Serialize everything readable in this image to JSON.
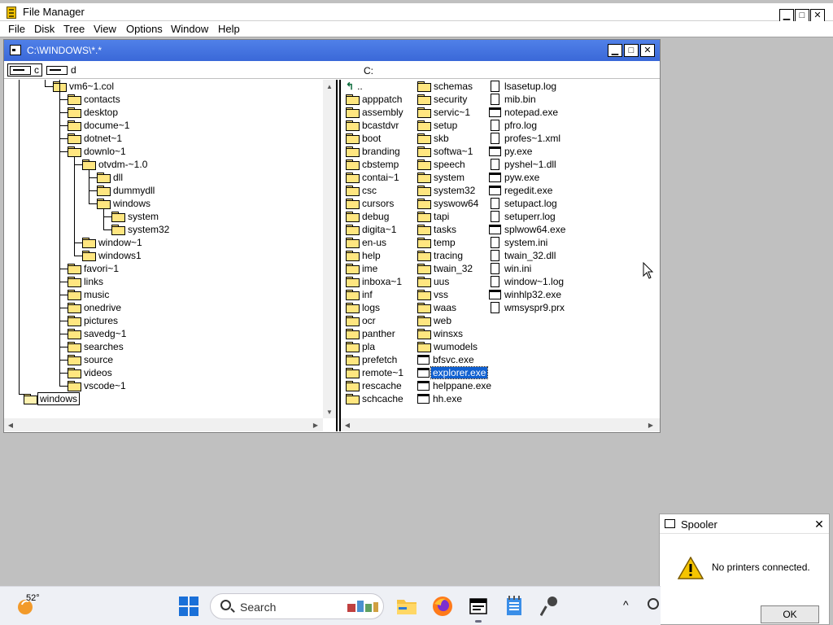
{
  "file_manager": {
    "title": "File Manager",
    "menu": [
      "File",
      "Disk",
      "Tree",
      "View",
      "Options",
      "Window",
      "Help"
    ]
  },
  "child_window": {
    "title": "C:\\WINDOWS\\*.*",
    "drives": [
      {
        "label": "c",
        "selected": true
      },
      {
        "label": "d",
        "selected": false
      }
    ],
    "current_drive": "C:"
  },
  "tree": [
    {
      "name": "vm6~1.col",
      "depth": 1
    },
    {
      "name": "contacts",
      "depth": 2
    },
    {
      "name": "desktop",
      "depth": 2
    },
    {
      "name": "docume~1",
      "depth": 2
    },
    {
      "name": "dotnet~1",
      "depth": 2
    },
    {
      "name": "downlo~1",
      "depth": 2
    },
    {
      "name": "otvdm-~1.0",
      "depth": 3
    },
    {
      "name": "dll",
      "depth": 4
    },
    {
      "name": "dummydll",
      "depth": 4
    },
    {
      "name": "windows",
      "depth": 4
    },
    {
      "name": "system",
      "depth": 5
    },
    {
      "name": "system32",
      "depth": 5
    },
    {
      "name": "window~1",
      "depth": 3
    },
    {
      "name": "windows1",
      "depth": 3
    },
    {
      "name": "favori~1",
      "depth": 2
    },
    {
      "name": "links",
      "depth": 2
    },
    {
      "name": "music",
      "depth": 2
    },
    {
      "name": "onedrive",
      "depth": 2
    },
    {
      "name": "pictures",
      "depth": 2
    },
    {
      "name": "savedg~1",
      "depth": 2
    },
    {
      "name": "searches",
      "depth": 2
    },
    {
      "name": "source",
      "depth": 2
    },
    {
      "name": "videos",
      "depth": 2
    },
    {
      "name": "vscode~1",
      "depth": 2
    },
    {
      "name": "windows",
      "depth": 0,
      "open": true,
      "focused": true
    }
  ],
  "files": {
    "col1": [
      {
        "name": "..",
        "type": "up"
      },
      {
        "name": "apppatch",
        "type": "folder"
      },
      {
        "name": "assembly",
        "type": "folder"
      },
      {
        "name": "bcastdvr",
        "type": "folder"
      },
      {
        "name": "boot",
        "type": "folder"
      },
      {
        "name": "branding",
        "type": "folder"
      },
      {
        "name": "cbstemp",
        "type": "folder"
      },
      {
        "name": "contai~1",
        "type": "folder"
      },
      {
        "name": "csc",
        "type": "folder"
      },
      {
        "name": "cursors",
        "type": "folder"
      },
      {
        "name": "debug",
        "type": "folder"
      },
      {
        "name": "digita~1",
        "type": "folder"
      },
      {
        "name": "en-us",
        "type": "folder"
      },
      {
        "name": "help",
        "type": "folder"
      },
      {
        "name": "ime",
        "type": "folder"
      },
      {
        "name": "inboxa~1",
        "type": "folder"
      },
      {
        "name": "inf",
        "type": "folder"
      },
      {
        "name": "logs",
        "type": "folder"
      },
      {
        "name": "ocr",
        "type": "folder"
      },
      {
        "name": "panther",
        "type": "folder"
      },
      {
        "name": "pla",
        "type": "folder"
      },
      {
        "name": "prefetch",
        "type": "folder"
      },
      {
        "name": "remote~1",
        "type": "folder"
      },
      {
        "name": "rescache",
        "type": "folder"
      },
      {
        "name": "schcache",
        "type": "folder"
      }
    ],
    "col2": [
      {
        "name": "schemas",
        "type": "folder"
      },
      {
        "name": "security",
        "type": "folder"
      },
      {
        "name": "servic~1",
        "type": "folder"
      },
      {
        "name": "setup",
        "type": "folder"
      },
      {
        "name": "skb",
        "type": "folder"
      },
      {
        "name": "softwa~1",
        "type": "folder"
      },
      {
        "name": "speech",
        "type": "folder"
      },
      {
        "name": "system",
        "type": "folder"
      },
      {
        "name": "system32",
        "type": "folder"
      },
      {
        "name": "syswow64",
        "type": "folder"
      },
      {
        "name": "tapi",
        "type": "folder"
      },
      {
        "name": "tasks",
        "type": "folder"
      },
      {
        "name": "temp",
        "type": "folder"
      },
      {
        "name": "tracing",
        "type": "folder"
      },
      {
        "name": "twain_32",
        "type": "folder"
      },
      {
        "name": "uus",
        "type": "folder"
      },
      {
        "name": "vss",
        "type": "folder"
      },
      {
        "name": "waas",
        "type": "folder"
      },
      {
        "name": "web",
        "type": "folder"
      },
      {
        "name": "winsxs",
        "type": "folder"
      },
      {
        "name": "wumodels",
        "type": "folder"
      },
      {
        "name": "bfsvc.exe",
        "type": "exe"
      },
      {
        "name": "explorer.exe",
        "type": "exe",
        "selected": true
      },
      {
        "name": "helppane.exe",
        "type": "exe"
      },
      {
        "name": "hh.exe",
        "type": "exe"
      }
    ],
    "col3": [
      {
        "name": "lsasetup.log",
        "type": "file"
      },
      {
        "name": "mib.bin",
        "type": "file"
      },
      {
        "name": "notepad.exe",
        "type": "exe"
      },
      {
        "name": "pfro.log",
        "type": "file"
      },
      {
        "name": "profes~1.xml",
        "type": "file"
      },
      {
        "name": "py.exe",
        "type": "exe"
      },
      {
        "name": "pyshel~1.dll",
        "type": "file"
      },
      {
        "name": "pyw.exe",
        "type": "exe"
      },
      {
        "name": "regedit.exe",
        "type": "exe"
      },
      {
        "name": "setupact.log",
        "type": "file"
      },
      {
        "name": "setuperr.log",
        "type": "file"
      },
      {
        "name": "splwow64.exe",
        "type": "exe"
      },
      {
        "name": "system.ini",
        "type": "file"
      },
      {
        "name": "twain_32.dll",
        "type": "file"
      },
      {
        "name": "win.ini",
        "type": "file"
      },
      {
        "name": "window~1.log",
        "type": "file"
      },
      {
        "name": "winhlp32.exe",
        "type": "exe"
      },
      {
        "name": "wmsyspr9.prx",
        "type": "file"
      }
    ]
  },
  "dialog": {
    "title": "Spooler",
    "message": "No printers connected.",
    "ok_label": "OK",
    "close_glyph": "✕"
  },
  "taskbar": {
    "temperature": "52°",
    "search_label": "Search",
    "apps": [
      "file-explorer",
      "firefox",
      "file-manager",
      "notepad",
      "microphone"
    ]
  },
  "icons": {
    "minimize": "▁",
    "maximize": "□",
    "close": "✕",
    "restore": "❐"
  }
}
